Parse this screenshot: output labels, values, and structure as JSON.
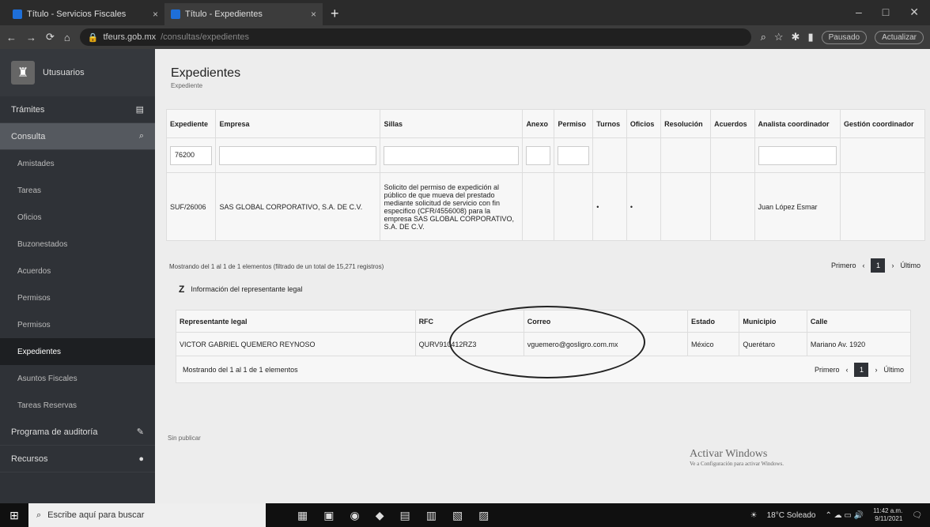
{
  "browser": {
    "tabs": [
      {
        "title": "Título - Servicios Fiscales"
      },
      {
        "title": "Título - Expedientes"
      }
    ],
    "url": "tfeurs.gob.mx",
    "url_path": "/consultas/expedientes",
    "buttons": {
      "new_tab": "+",
      "back": "←",
      "forward": "→",
      "reload": "⟳",
      "home": "⌂",
      "pill1": "Pausado",
      "pill2": "Actualizar"
    }
  },
  "sidebar": {
    "brand": "Utusuarios",
    "items": [
      {
        "label": "Trámites",
        "icon": "▤"
      },
      {
        "label": "Consulta",
        "icon": "⌕"
      }
    ],
    "subitems": [
      "Amistades",
      "Tareas",
      "Oficios",
      "Buzonestados",
      "Acuerdos",
      "Permisos",
      "Permisos",
      "Expedientes",
      "Asuntos Fiscales",
      "Tareas Reservas"
    ],
    "bottom": [
      {
        "label": "Programa de auditoría",
        "icon": "✎"
      },
      {
        "label": "Recursos",
        "icon": "●"
      }
    ]
  },
  "page": {
    "title": "Expedientes",
    "subtitle": "Expediente"
  },
  "table": {
    "headers": [
      "Expediente",
      "Empresa",
      "Sillas",
      "Anexo",
      "Permiso",
      "Turnos",
      "Oficios",
      "Resolución",
      "Acuerdos",
      "Analista coordinador",
      "Gestión coordinador"
    ],
    "filter_value": "76200",
    "row": {
      "expediente": "SUF/26006",
      "empresa": "SAS GLOBAL CORPORATIVO, S.A. DE C.V.",
      "sillas": "Solicito del permiso de expedición al público de que mueva del prestado mediante solicitud de servicio con fin especifico (CFR/4556008) para la empresa SAS GLOBAL CORPORATIVO, S.A. DE C.V.",
      "anexo": "",
      "permiso": "",
      "turnos": "•",
      "oficios": "•",
      "resolucion": "",
      "acuerdos": "",
      "analista": "Juan López Esmar",
      "gestion": ""
    },
    "info": "Mostrando del 1 al 1 de 1 elementos (filtrado de un total de 15,271 registros)"
  },
  "pager": {
    "prev": "Primero",
    "page": "1",
    "next": "Último"
  },
  "legal": {
    "title": "Información del representante legal",
    "icon": "Z",
    "headers": [
      "Representante legal",
      "RFC",
      "Correo",
      "Estado",
      "Municipio",
      "Calle"
    ],
    "row": {
      "nombre": "VICTOR GABRIEL QUEMERO REYNOSO",
      "rfc": "QURV910412RZ3",
      "correo": "vguemero@gosligro.com.mx",
      "estado": "México",
      "municipio": "Querétaro",
      "calle": "Mariano Av. 1920"
    },
    "info": "Mostrando del 1 al 1 de 1 elementos"
  },
  "footer_left": "Sin publicar",
  "activate": {
    "title": "Activar Windows",
    "sub": "Ve a Configuración para activar Windows."
  },
  "taskbar": {
    "search_placeholder": "Escribe aquí para buscar",
    "weather": "18°C Soleado",
    "time": "11:42 a.m.",
    "date": "9/11/2021"
  }
}
